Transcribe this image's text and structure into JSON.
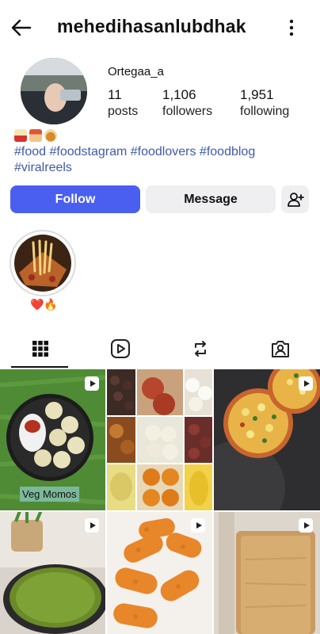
{
  "header": {
    "username": "mehedihasanlubdhak",
    "back_icon": "arrow-left-icon",
    "more_icon": "vertical-dots-icon"
  },
  "profile": {
    "display_name": "Ortegaa_a",
    "stats": {
      "posts": {
        "value": "11",
        "label": "posts"
      },
      "followers": {
        "value": "1,106",
        "label": "followers"
      },
      "following": {
        "value": "1,951",
        "label": "following"
      }
    },
    "bio_emojis": [
      "popcorn",
      "cake",
      "pancakes"
    ],
    "hashtags": "#food #foodstagram #foodlovers #foodblog #viralreels"
  },
  "actions": {
    "follow_label": "Follow",
    "message_label": "Message",
    "add_user_icon": "person-plus-icon"
  },
  "highlights": [
    {
      "label_emojis": "❤️🔥",
      "cover": "pizza-cheese"
    }
  ],
  "tabs": [
    {
      "name": "posts",
      "icon": "grid-icon",
      "active": true
    },
    {
      "name": "reels",
      "icon": "reels-icon",
      "active": false
    },
    {
      "name": "reposts",
      "icon": "repost-icon",
      "active": false
    },
    {
      "name": "tagged",
      "icon": "tagged-person-icon",
      "active": false
    }
  ],
  "grid": {
    "posts": [
      {
        "caption": "Veg Momos",
        "reel": true
      },
      {
        "caption": "",
        "reel": false
      },
      {
        "caption": "",
        "reel": true
      },
      {
        "caption": "",
        "reel": true
      },
      {
        "caption": "",
        "reel": true
      },
      {
        "caption": "",
        "reel": true
      }
    ]
  },
  "colors": {
    "accent": "#4a5ff0",
    "hashtag": "#3f5ab1",
    "button_bg": "#efeff2"
  }
}
